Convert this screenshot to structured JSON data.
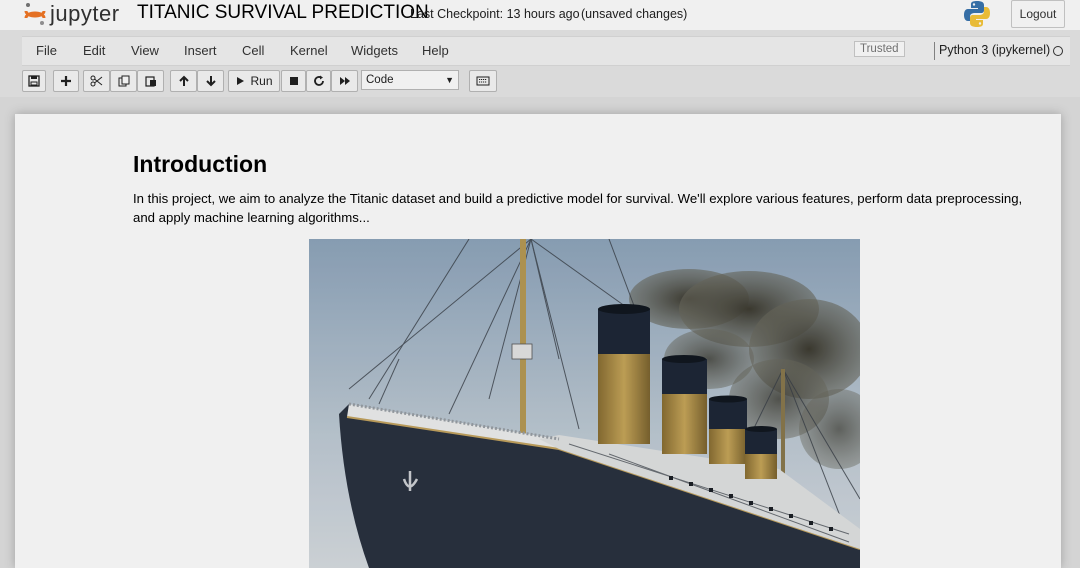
{
  "header": {
    "logo_text": "jupyter",
    "notebook_title": "TITANIC SURVIVAL PREDICTION",
    "checkpoint": "Last Checkpoint: 13 hours ago",
    "save_status": "(unsaved changes)",
    "logout_label": "Logout"
  },
  "menubar": {
    "items": [
      "File",
      "Edit",
      "View",
      "Insert",
      "Cell",
      "Kernel",
      "Widgets",
      "Help"
    ],
    "trusted_label": "Trusted",
    "kernel_name": "Python 3 (ipykernel)"
  },
  "toolbar": {
    "buttons": [
      "save-icon",
      "add-cell-icon",
      "cut-icon",
      "copy-icon",
      "paste-icon",
      "move-up-icon",
      "move-down-icon",
      "run-icon",
      "stop-icon",
      "restart-icon",
      "fast-forward-icon",
      "keyboard-icon"
    ],
    "run_label": "Run",
    "cell_type": "Code"
  },
  "cell": {
    "heading": "Introduction",
    "paragraph": "In this project, we aim to analyze the Titanic dataset and build a predictive model for survival. We'll explore various features, perform data preprocessing, and apply machine learning algorithms..."
  },
  "colors": {
    "sky": "#aab8c6",
    "hull": "#2c3444",
    "funnel_gold": "#b0924a",
    "funnel_top": "#1e2838",
    "smoke": "#4d4a3c"
  }
}
